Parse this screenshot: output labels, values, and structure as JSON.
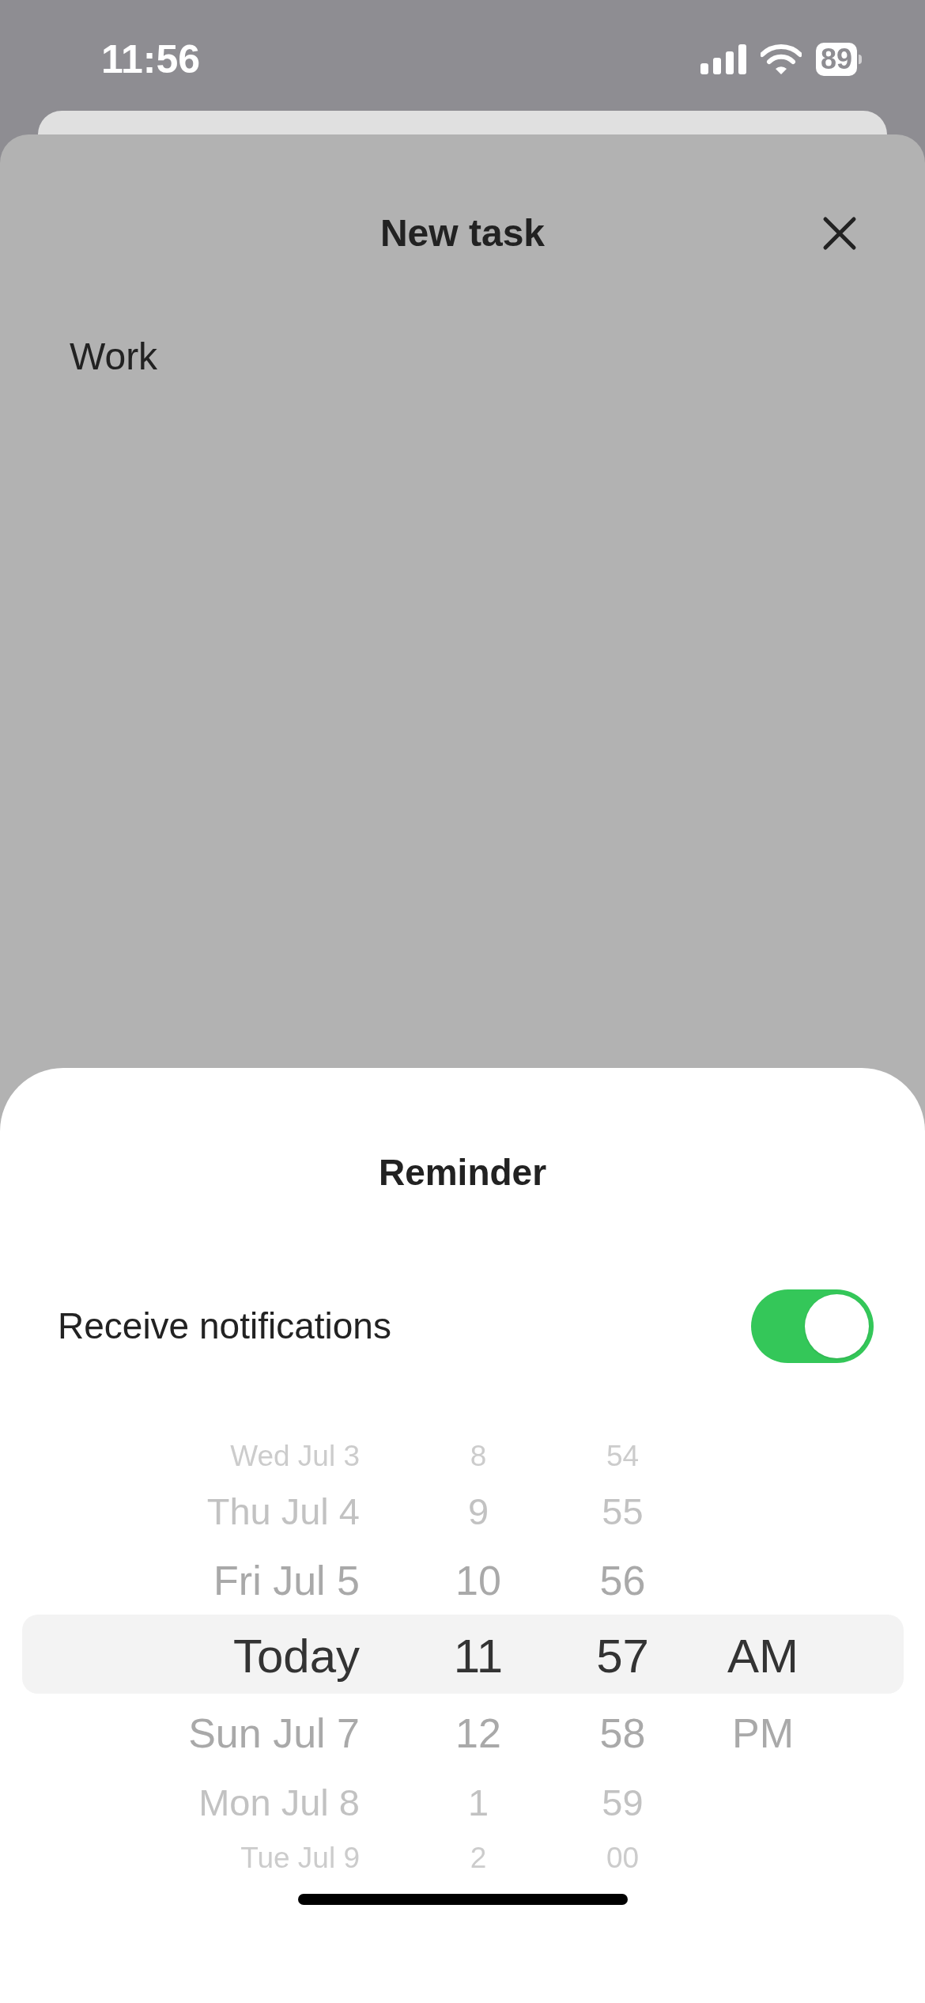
{
  "status_bar": {
    "time": "11:56",
    "battery": "89"
  },
  "task_sheet": {
    "title": "New task",
    "list_name": "Work"
  },
  "reminder_sheet": {
    "title": "Reminder",
    "notifications": {
      "label": "Receive notifications",
      "on": true
    },
    "picker": {
      "date": [
        {
          "label": "Wed Jul 3",
          "selected": false
        },
        {
          "label": "Thu Jul 4",
          "selected": false
        },
        {
          "label": "Fri Jul 5",
          "selected": false
        },
        {
          "label": "Today",
          "selected": true
        },
        {
          "label": "Sun Jul 7",
          "selected": false
        },
        {
          "label": "Mon Jul 8",
          "selected": false
        },
        {
          "label": "Tue Jul 9",
          "selected": false
        }
      ],
      "hour": [
        {
          "label": "8",
          "selected": false
        },
        {
          "label": "9",
          "selected": false
        },
        {
          "label": "10",
          "selected": false
        },
        {
          "label": "11",
          "selected": true
        },
        {
          "label": "12",
          "selected": false
        },
        {
          "label": "1",
          "selected": false
        },
        {
          "label": "2",
          "selected": false
        }
      ],
      "minute": [
        {
          "label": "54",
          "selected": false
        },
        {
          "label": "55",
          "selected": false
        },
        {
          "label": "56",
          "selected": false
        },
        {
          "label": "57",
          "selected": true
        },
        {
          "label": "58",
          "selected": false
        },
        {
          "label": "59",
          "selected": false
        },
        {
          "label": "00",
          "selected": false
        }
      ],
      "period": [
        {
          "label": "AM",
          "selected": true
        },
        {
          "label": "PM",
          "selected": false
        }
      ]
    }
  }
}
